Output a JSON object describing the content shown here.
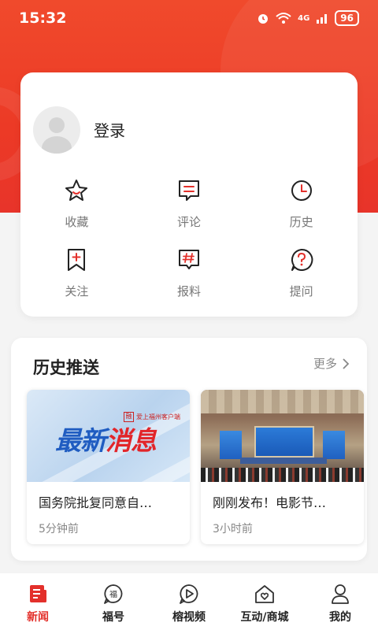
{
  "status_bar": {
    "time": "15:32",
    "network": "4G",
    "battery": "96"
  },
  "profile": {
    "login_label": "登录"
  },
  "quick_actions": [
    {
      "label": "收藏",
      "icon": "star-icon"
    },
    {
      "label": "评论",
      "icon": "comment-icon"
    },
    {
      "label": "历史",
      "icon": "clock-icon"
    },
    {
      "label": "关注",
      "icon": "bookmark-plus-icon"
    },
    {
      "label": "报料",
      "icon": "hashtag-icon"
    },
    {
      "label": "提问",
      "icon": "question-icon"
    }
  ],
  "history": {
    "title": "历史推送",
    "more_label": "更多",
    "items": [
      {
        "image_text_a": "最新",
        "image_text_b": "消息",
        "image_logo": "爱上福州客户端",
        "title": "国务院批复同意自…",
        "time": "5分钟前"
      },
      {
        "title": "刚刚发布！电影节…",
        "time": "3小时前"
      }
    ]
  },
  "tabbar": {
    "active": "新闻",
    "items": [
      {
        "label": "新闻",
        "icon": "news-icon"
      },
      {
        "label": "福号",
        "icon": "fuhao-icon"
      },
      {
        "label": "榕视频",
        "icon": "video-icon"
      },
      {
        "label": "互动/商城",
        "icon": "home-heart-icon"
      },
      {
        "label": "我的",
        "icon": "user-icon"
      }
    ]
  },
  "colors": {
    "accent": "#e3302b",
    "hero": "#ec3a26"
  }
}
